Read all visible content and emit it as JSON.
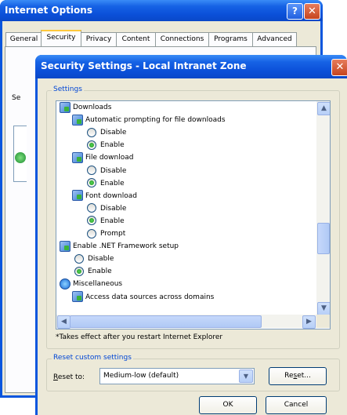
{
  "internet_options": {
    "title": "Internet Options",
    "help_glyph": "?",
    "close_glyph": "✕",
    "tabs": [
      {
        "label": "General"
      },
      {
        "label": "Security"
      },
      {
        "label": "Privacy"
      },
      {
        "label": "Content"
      },
      {
        "label": "Connections"
      },
      {
        "label": "Programs"
      },
      {
        "label": "Advanced"
      }
    ],
    "active_tab": "Security",
    "partial_text": "Se"
  },
  "security_dialog": {
    "title": "Security Settings - Local Intranet Zone",
    "close_glyph": "✕",
    "settings_group_label": "Settings",
    "tree": [
      {
        "type": "category",
        "icon": "settings-category-icon",
        "label": "Downloads"
      },
      {
        "type": "setting",
        "icon": "setting-icon",
        "label": "Automatic prompting for file downloads"
      },
      {
        "type": "option",
        "label": "Disable",
        "selected": false
      },
      {
        "type": "option",
        "label": "Enable",
        "selected": true
      },
      {
        "type": "setting",
        "icon": "setting-icon",
        "label": "File download"
      },
      {
        "type": "option",
        "label": "Disable",
        "selected": false
      },
      {
        "type": "option",
        "label": "Enable",
        "selected": true
      },
      {
        "type": "setting",
        "icon": "setting-icon",
        "label": "Font download"
      },
      {
        "type": "option",
        "label": "Disable",
        "selected": false
      },
      {
        "type": "option",
        "label": "Enable",
        "selected": true
      },
      {
        "type": "option",
        "label": "Prompt",
        "selected": false
      },
      {
        "type": "category",
        "icon": "settings-category-icon",
        "label": "Enable .NET Framework setup"
      },
      {
        "type": "option",
        "label": "Disable",
        "selected": false
      },
      {
        "type": "option",
        "label": "Enable",
        "selected": true
      },
      {
        "type": "category",
        "icon": "ie-icon",
        "label": "Miscellaneous"
      },
      {
        "type": "setting",
        "icon": "setting-icon",
        "label": "Access data sources across domains"
      }
    ],
    "footnote": "*Takes effect after you restart Internet Explorer",
    "reset_group_label": "Reset custom settings",
    "reset_to_label": "Reset to:",
    "reset_to_value": "Medium-low (default)",
    "reset_button": "Reset...",
    "ok_button": "OK",
    "cancel_button": "Cancel"
  }
}
